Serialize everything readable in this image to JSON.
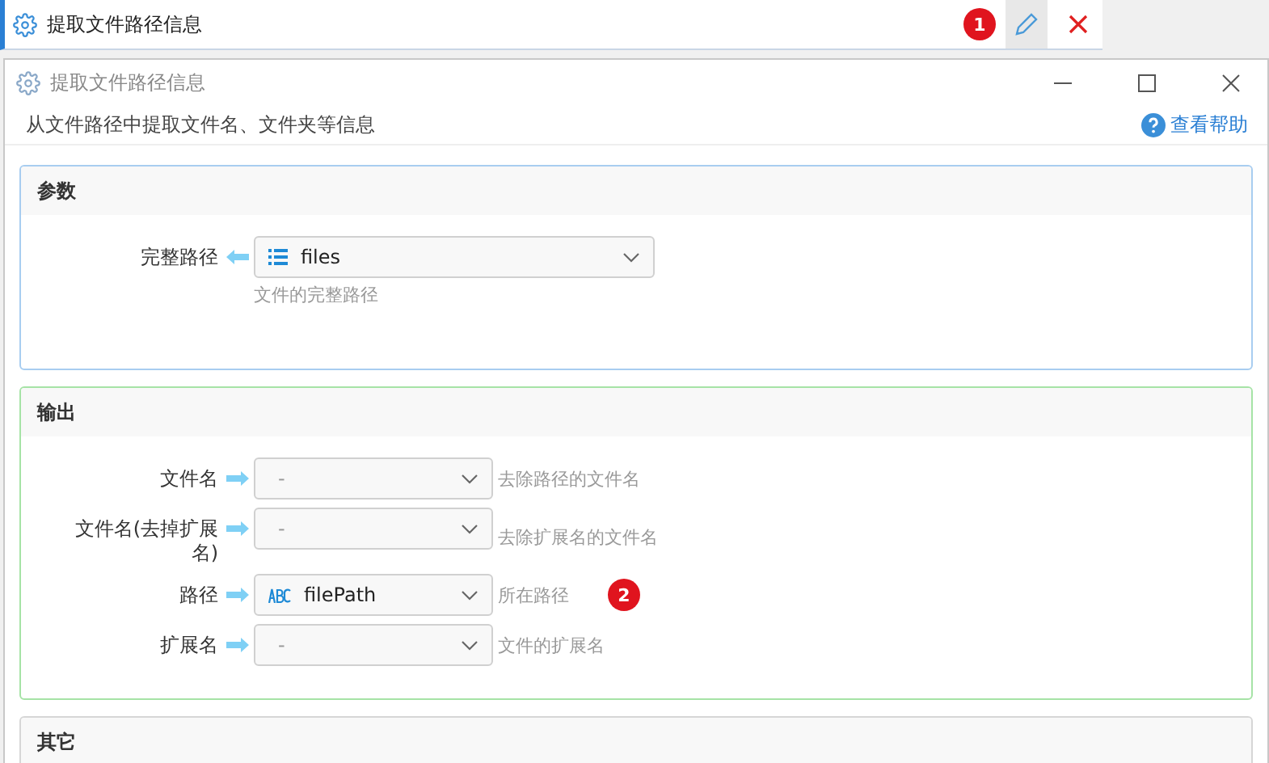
{
  "step_bar": {
    "title": "提取文件路径信息",
    "badge": "1"
  },
  "window": {
    "title": "提取文件路径信息"
  },
  "description": "从文件路径中提取文件名、文件夹等信息",
  "help_link": "查看帮助",
  "sections": [
    {
      "title": "参数",
      "kind": "input",
      "rows": [
        {
          "label": "完整路径",
          "value": "files",
          "kind": "list",
          "hint": "文件的完整路径"
        }
      ]
    },
    {
      "title": "输出",
      "kind": "output",
      "rows": [
        {
          "label": "文件名",
          "placeholder": "-",
          "hint": "去除路径的文件名"
        },
        {
          "label": "文件名(去掉扩展名)",
          "placeholder": "-",
          "hint": "去除扩展名的文件名"
        },
        {
          "label": "路径",
          "value": "filePath",
          "kind": "text",
          "hint": "所在路径",
          "badge": "2"
        },
        {
          "label": "扩展名",
          "placeholder": "-",
          "hint": "文件的扩展名"
        }
      ]
    },
    {
      "title": "其它",
      "kind": "other"
    }
  ]
}
